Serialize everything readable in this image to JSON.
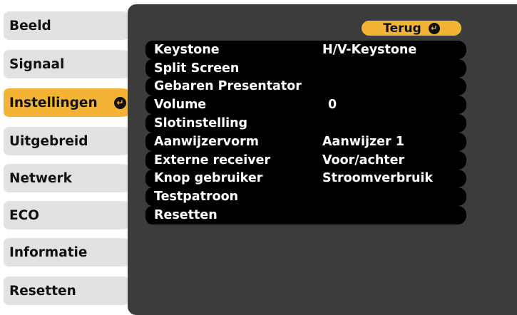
{
  "sidebar": {
    "items": [
      {
        "label": "Beeld"
      },
      {
        "label": "Signaal"
      },
      {
        "label": "Instellingen"
      },
      {
        "label": "Uitgebreid"
      },
      {
        "label": "Netwerk"
      },
      {
        "label": "ECO"
      },
      {
        "label": "Informatie"
      },
      {
        "label": "Resetten"
      }
    ]
  },
  "panel": {
    "back_label": "Terug",
    "rows": [
      {
        "label": "Keystone",
        "value": "H/V-Keystone"
      },
      {
        "label": "Split Screen",
        "value": ""
      },
      {
        "label": "Gebaren Presentator",
        "value": ""
      },
      {
        "label": "Volume",
        "value": "0"
      },
      {
        "label": "Slotinstelling",
        "value": ""
      },
      {
        "label": "Aanwijzervorm",
        "value": "Aanwijzer 1"
      },
      {
        "label": "Externe receiver",
        "value": "Voor/achter"
      },
      {
        "label": "Knop gebruiker",
        "value": "Stroomverbruik"
      },
      {
        "label": "Testpatroon",
        "value": ""
      },
      {
        "label": "Resetten",
        "value": ""
      }
    ]
  },
  "colors": {
    "accent": "#f3b335",
    "tab_bg": "#e2e2e2",
    "panel_bg": "#3c3c3c",
    "row_bg": "#000000"
  }
}
